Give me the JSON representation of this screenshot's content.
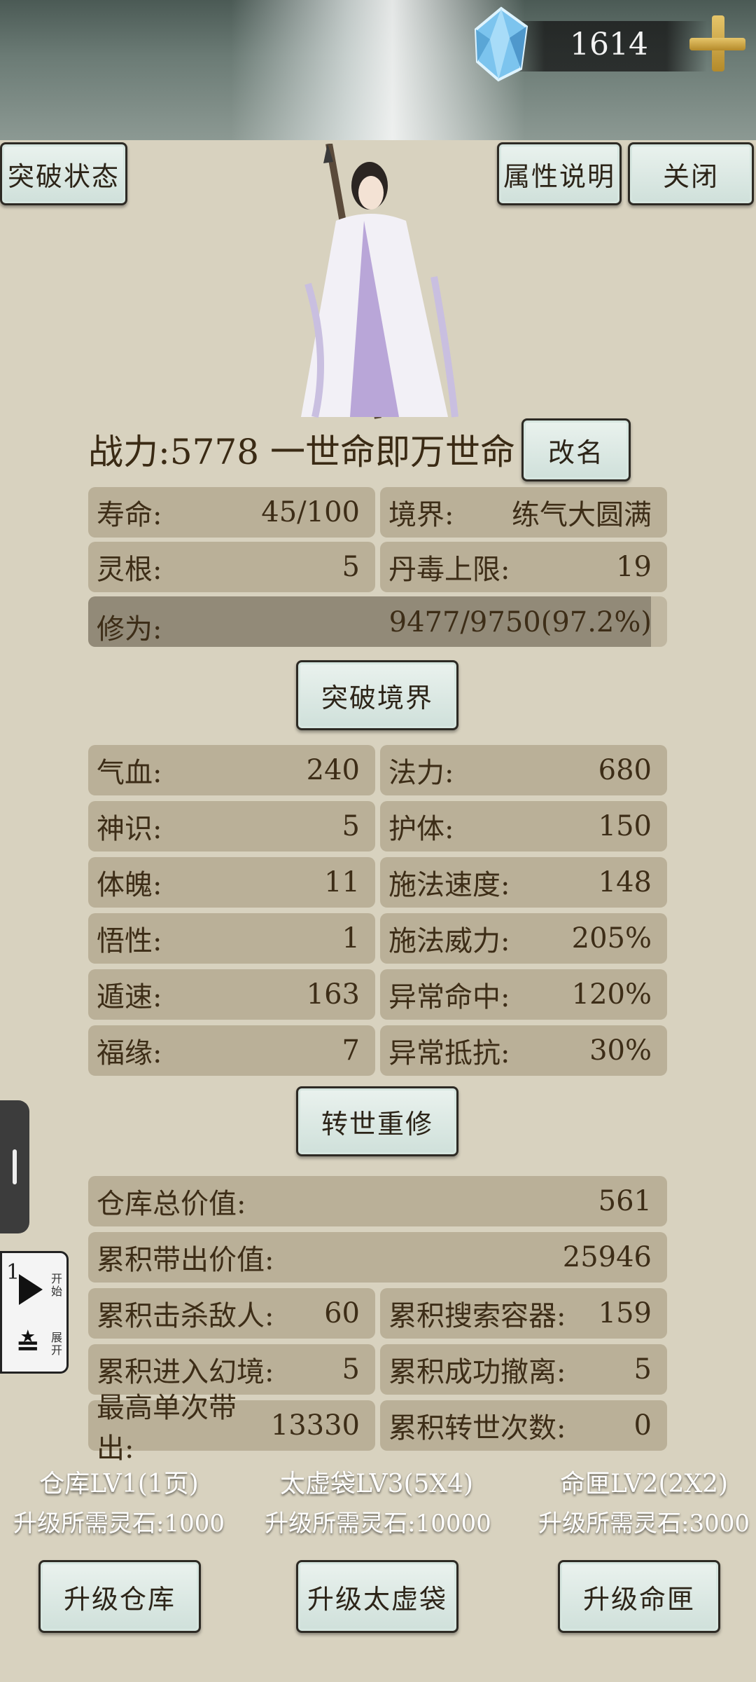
{
  "currency": {
    "value": "1614",
    "icon": "spirit-crystal-icon"
  },
  "header_buttons": {
    "breakthrough_status": "突破状态",
    "attribute_info": "属性说明",
    "close": "关闭"
  },
  "character": {
    "power_label": "战力:5778",
    "name": "一世命即万世命",
    "rename": "改名"
  },
  "basic_stats": [
    {
      "label": "寿命:",
      "value": "45/100"
    },
    {
      "label": "境界:",
      "value": "练气大圆满"
    },
    {
      "label": "灵根:",
      "value": "5"
    },
    {
      "label": "丹毒上限:",
      "value": "19"
    }
  ],
  "cultivation": {
    "label": "修为:",
    "value": "9477/9750(97.2%)",
    "progress": 0.972
  },
  "breakthrough_button": "突破境界",
  "attributes": [
    {
      "label": "气血:",
      "value": "240"
    },
    {
      "label": "法力:",
      "value": "680"
    },
    {
      "label": "神识:",
      "value": "5"
    },
    {
      "label": "护体:",
      "value": "150"
    },
    {
      "label": "体魄:",
      "value": "11"
    },
    {
      "label": "施法速度:",
      "value": "148"
    },
    {
      "label": "悟性:",
      "value": "1"
    },
    {
      "label": "施法威力:",
      "value": "205%"
    },
    {
      "label": "遁速:",
      "value": "163"
    },
    {
      "label": "异常命中:",
      "value": "120%"
    },
    {
      "label": "福缘:",
      "value": "7"
    },
    {
      "label": "异常抵抗:",
      "value": "30%"
    }
  ],
  "reincarnate_button": "转世重修",
  "records": {
    "warehouse_total": {
      "label": "仓库总价值:",
      "value": "561"
    },
    "carried_out": {
      "label": "累积带出价值:",
      "value": "25946"
    },
    "grid": [
      {
        "label": "累积击杀敌人:",
        "value": "60"
      },
      {
        "label": "累积搜索容器:",
        "value": "159"
      },
      {
        "label": "累积进入幻境:",
        "value": "5"
      },
      {
        "label": "累积成功撤离:",
        "value": "5"
      },
      {
        "label": "最高单次带出:",
        "value": "13330"
      },
      {
        "label": "累积转世次数:",
        "value": "0"
      }
    ]
  },
  "storage": [
    {
      "title": "仓库LV1(1页)",
      "cost": "升级所需灵石:1000",
      "button": "升级仓库"
    },
    {
      "title": "太虚袋LV3(5X4)",
      "cost": "升级所需灵石:10000",
      "button": "升级太虚袋"
    },
    {
      "title": "命匣LV2(2X2)",
      "cost": "升级所需灵石:3000",
      "button": "升级命匣"
    }
  ],
  "side_panel": {
    "number": "1",
    "start": "开始",
    "expand": "展开"
  }
}
